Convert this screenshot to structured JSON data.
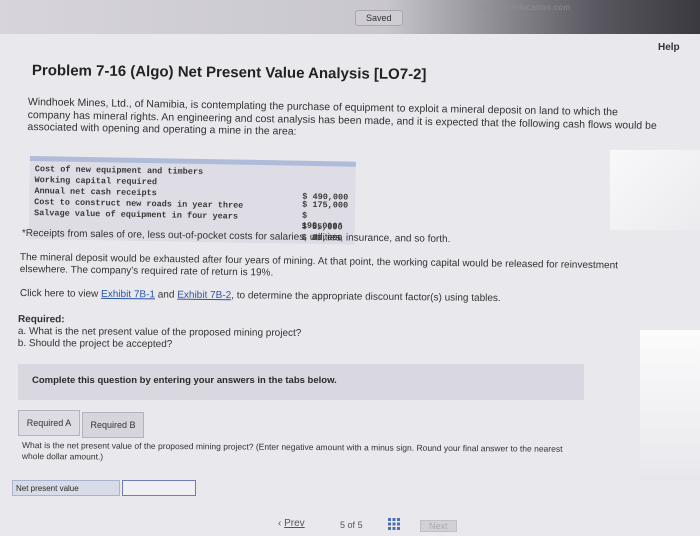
{
  "header": {
    "saved_label": "Saved",
    "url_fragment": "ezto.mheducation.com"
  },
  "help_label": "Help",
  "problem": {
    "title": "Problem 7-16 (Algo) Net Present Value Analysis [LO7-2]",
    "intro": "Windhoek Mines, Ltd., of Namibia, is contemplating the purchase of equipment to exploit a mineral deposit on land to which the company has mineral rights. An engineering and cost analysis has been made, and it is expected that the following cash flows would be associated with opening and operating a mine in the area:",
    "cash_flows": [
      {
        "label": "Cost of new equipment and timbers",
        "value": "$ 490,000"
      },
      {
        "label": "Working capital required",
        "value": "$ 175,000"
      },
      {
        "label": "Annual net cash receipts",
        "value": "$ 190,000*"
      },
      {
        "label": "Cost to construct new roads in year three",
        "value": "$  55,000"
      },
      {
        "label": "Salvage value of equipment in four years",
        "value": "$  80,000"
      }
    ],
    "footnote": "*Receipts from sales of ore, less out-of-pocket costs for salaries, utilities, insurance, and so forth.",
    "para2": "The mineral deposit would be exhausted after four years of mining. At that point, the working capital would be released for reinvestment elsewhere. The company's required rate of return is 19%.",
    "exhibit_prefix": "Click here to view ",
    "exhibit_link_1": "Exhibit 7B-1",
    "exhibit_and": " and ",
    "exhibit_link_2": "Exhibit 7B-2",
    "exhibit_suffix": ", to determine the appropriate discount factor(s) using tables.",
    "required_heading": "Required:",
    "required_a": "a. What is the net present value of the proposed mining project?",
    "required_b": "b. Should the project be accepted?"
  },
  "instruction": "Complete this question by entering your answers in the tabs below.",
  "tabs": [
    {
      "label": "Required A"
    },
    {
      "label": "Required B"
    }
  ],
  "question": "What is the net present value of the proposed mining project? (Enter negative amount with a minus sign. Round your final answer to the nearest whole dollar amount.)",
  "answer": {
    "label": "Net present value",
    "value": ""
  },
  "navigation": {
    "prev_label": "Prev",
    "page_current": "5",
    "page_of": "of",
    "page_total": "5",
    "next_label": "Next"
  }
}
